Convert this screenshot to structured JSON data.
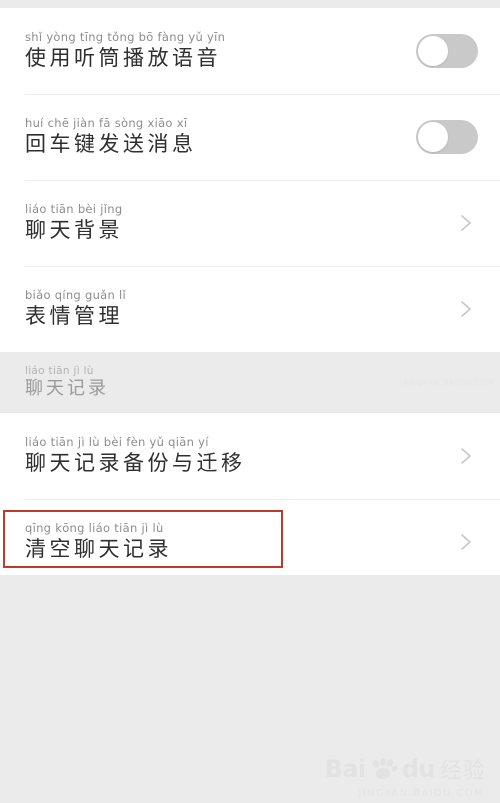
{
  "groups": [
    {
      "name": "settings-group-top",
      "rows": [
        {
          "pinyin": "shǐ yòng tīng tǒng bō fàng yǔ yīn",
          "hanzi": "使用听筒播放语音",
          "control": "toggle",
          "toggle_state": "off",
          "name": "row-use-earpiece-playback"
        },
        {
          "pinyin": "huí chē jiàn fā sòng xiāo xī",
          "hanzi": "回车键发送消息",
          "control": "toggle",
          "toggle_state": "off",
          "name": "row-enter-key-send-message"
        },
        {
          "pinyin": "liáo tiān bèi jǐng",
          "hanzi": "聊天背景",
          "control": "chevron",
          "name": "row-chat-background"
        },
        {
          "pinyin": "biǎo qíng guǎn lǐ",
          "hanzi": "表情管理",
          "control": "chevron",
          "name": "row-emoji-management"
        }
      ]
    },
    {
      "name": "settings-group-chat-history",
      "rows": [
        {
          "pinyin": "liáo tiān jì lù bèi fèn yǔ qiān yí",
          "hanzi": "聊天记录备份与迁移",
          "control": "chevron",
          "name": "row-chat-history-backup-migrate"
        },
        {
          "pinyin": "qīng kōng liáo tiān jì lù",
          "hanzi": "清空聊天记录",
          "control": "chevron",
          "highlighted": true,
          "name": "row-clear-chat-history"
        }
      ]
    }
  ],
  "section_header": {
    "pinyin": "liáo tiān jì lù",
    "hanzi": "聊天记录"
  },
  "annotation": {
    "color": "#c0392b",
    "target": "row-clear-chat-history"
  },
  "watermark": {
    "brand": "Bai",
    "brand_suffix": "du",
    "product": "经验",
    "sub": "JINGYAN.BAIDU.COM"
  },
  "colors": {
    "page_background": "#ebebeb",
    "card_background": "#ffffff",
    "hanzi_text": "#2f2f2f",
    "pinyin_text": "#8d8d8d",
    "section_text": "#9a9a9a",
    "toggle_track_off": "#c9c9c9",
    "toggle_knob": "#ffffff",
    "chevron": "#c8c8c8",
    "divider": "#eeeeee",
    "annotation_red": "#c0392b"
  }
}
